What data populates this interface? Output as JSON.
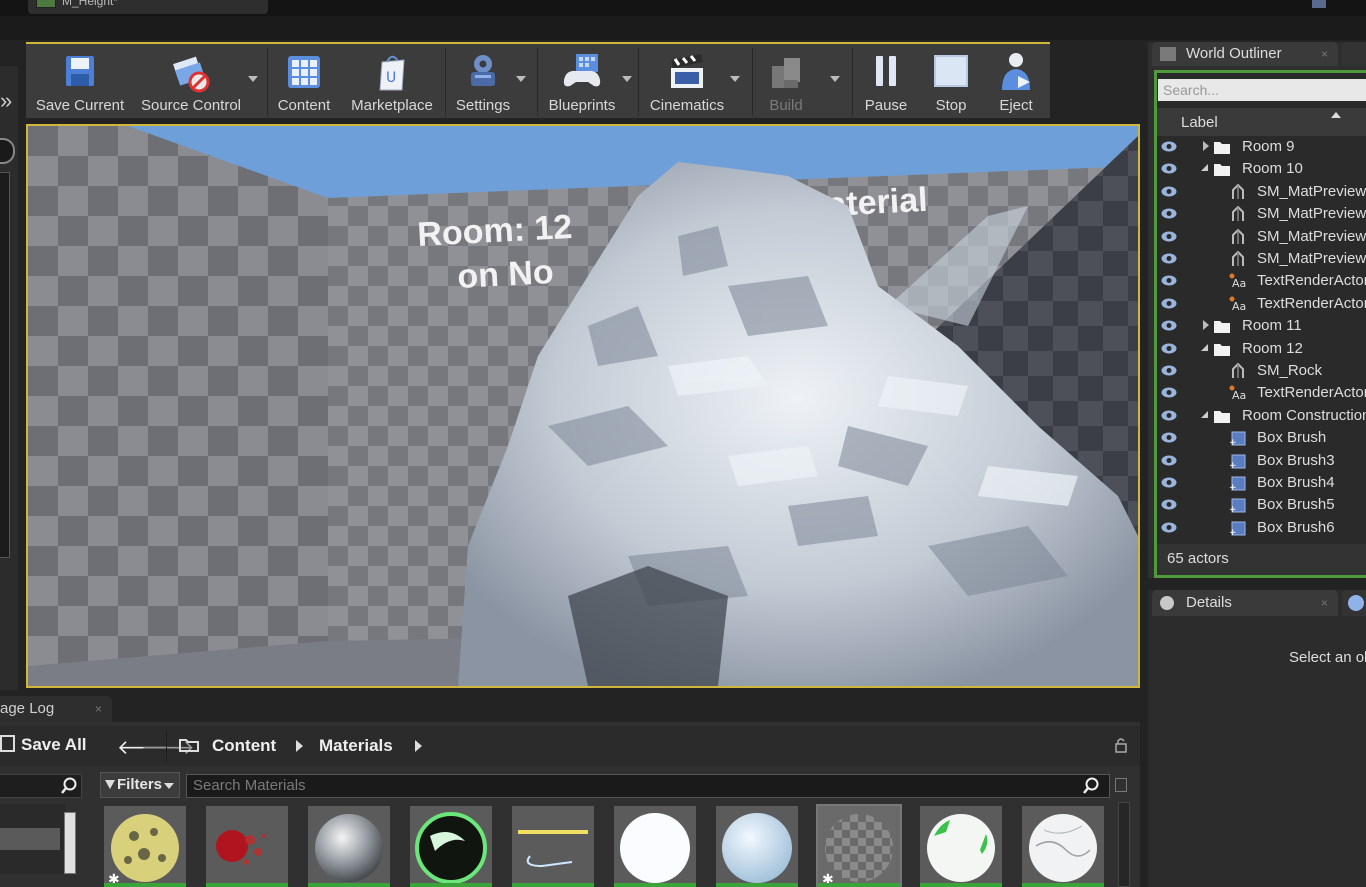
{
  "window": {
    "document_tab": "M_Height*"
  },
  "toolbar": {
    "buttons": [
      {
        "label": "Save Current",
        "icon": "floppy-disk-icon"
      },
      {
        "label": "Source Control",
        "icon": "source-control-icon"
      },
      {
        "label": "Content",
        "icon": "content-grid-icon"
      },
      {
        "label": "Marketplace",
        "icon": "marketplace-bag-icon"
      },
      {
        "label": "Settings",
        "icon": "settings-gears-icon"
      },
      {
        "label": "Blueprints",
        "icon": "blueprints-gamepad-icon"
      },
      {
        "label": "Cinematics",
        "icon": "clapperboard-icon"
      },
      {
        "label": "Build",
        "icon": "build-blocks-icon",
        "disabled": true
      },
      {
        "label": "Pause",
        "icon": "pause-icon"
      },
      {
        "label": "Stop",
        "icon": "stop-icon"
      },
      {
        "label": "Eject",
        "icon": "eject-person-icon"
      }
    ]
  },
  "viewport": {
    "scene_text_line1": "Room: 12",
    "scene_text_line1_right": "aterial",
    "scene_text_line2": "on No",
    "colors": {
      "sky": "#6f9fd8",
      "frame": "#d0b63a"
    }
  },
  "message_log": {
    "tab_label": "age Log"
  },
  "content_browser": {
    "save_all_label": "Save All",
    "path": [
      "Content",
      "Materials"
    ],
    "filters_label": "Filters",
    "search_placeholder": "Search Materials",
    "assets": [
      {
        "icon": "yellow-rock-sphere"
      },
      {
        "icon": "red-splatter"
      },
      {
        "icon": "chrome-sphere"
      },
      {
        "icon": "green-rim-sphere"
      },
      {
        "icon": "line-effect"
      },
      {
        "icon": "white-sphere"
      },
      {
        "icon": "light-blue-sphere"
      },
      {
        "icon": "checker-sphere"
      },
      {
        "icon": "white-green-sphere"
      },
      {
        "icon": "marble-sphere"
      }
    ]
  },
  "world_outliner": {
    "tab_label": "World Outliner",
    "search_placeholder": "Search...",
    "column_label": "Label",
    "rows": [
      {
        "label": "Room 9",
        "type": "folder",
        "expander": "closed",
        "indent": 0
      },
      {
        "label": "Room 10",
        "type": "folder",
        "expander": "open",
        "indent": 0
      },
      {
        "label": "SM_MatPreviewMesh",
        "type": "static-mesh",
        "indent": 1
      },
      {
        "label": "SM_MatPreviewMesh",
        "type": "static-mesh",
        "indent": 1
      },
      {
        "label": "SM_MatPreviewMesh",
        "type": "static-mesh",
        "indent": 1
      },
      {
        "label": "SM_MatPreviewMesh",
        "type": "static-mesh",
        "indent": 1
      },
      {
        "label": "TextRenderActor",
        "type": "text-render",
        "indent": 1
      },
      {
        "label": "TextRenderActor",
        "type": "text-render",
        "indent": 1
      },
      {
        "label": "Room 11",
        "type": "folder",
        "expander": "closed",
        "indent": 0
      },
      {
        "label": "Room 12",
        "type": "folder",
        "expander": "open",
        "indent": 0
      },
      {
        "label": "SM_Rock",
        "type": "static-mesh",
        "indent": 1
      },
      {
        "label": "TextRenderActor",
        "type": "text-render",
        "indent": 1
      },
      {
        "label": "Room Construction",
        "type": "folder",
        "expander": "open",
        "indent": 0
      },
      {
        "label": "Box Brush",
        "type": "brush",
        "indent": 1
      },
      {
        "label": "Box Brush3",
        "type": "brush",
        "indent": 1
      },
      {
        "label": "Box Brush4",
        "type": "brush",
        "indent": 1
      },
      {
        "label": "Box Brush5",
        "type": "brush",
        "indent": 1
      },
      {
        "label": "Box Brush6",
        "type": "brush",
        "indent": 1
      }
    ],
    "actor_count": "65 actors"
  },
  "details": {
    "tab_label": "Details",
    "empty_message": "Select an object to view details."
  }
}
